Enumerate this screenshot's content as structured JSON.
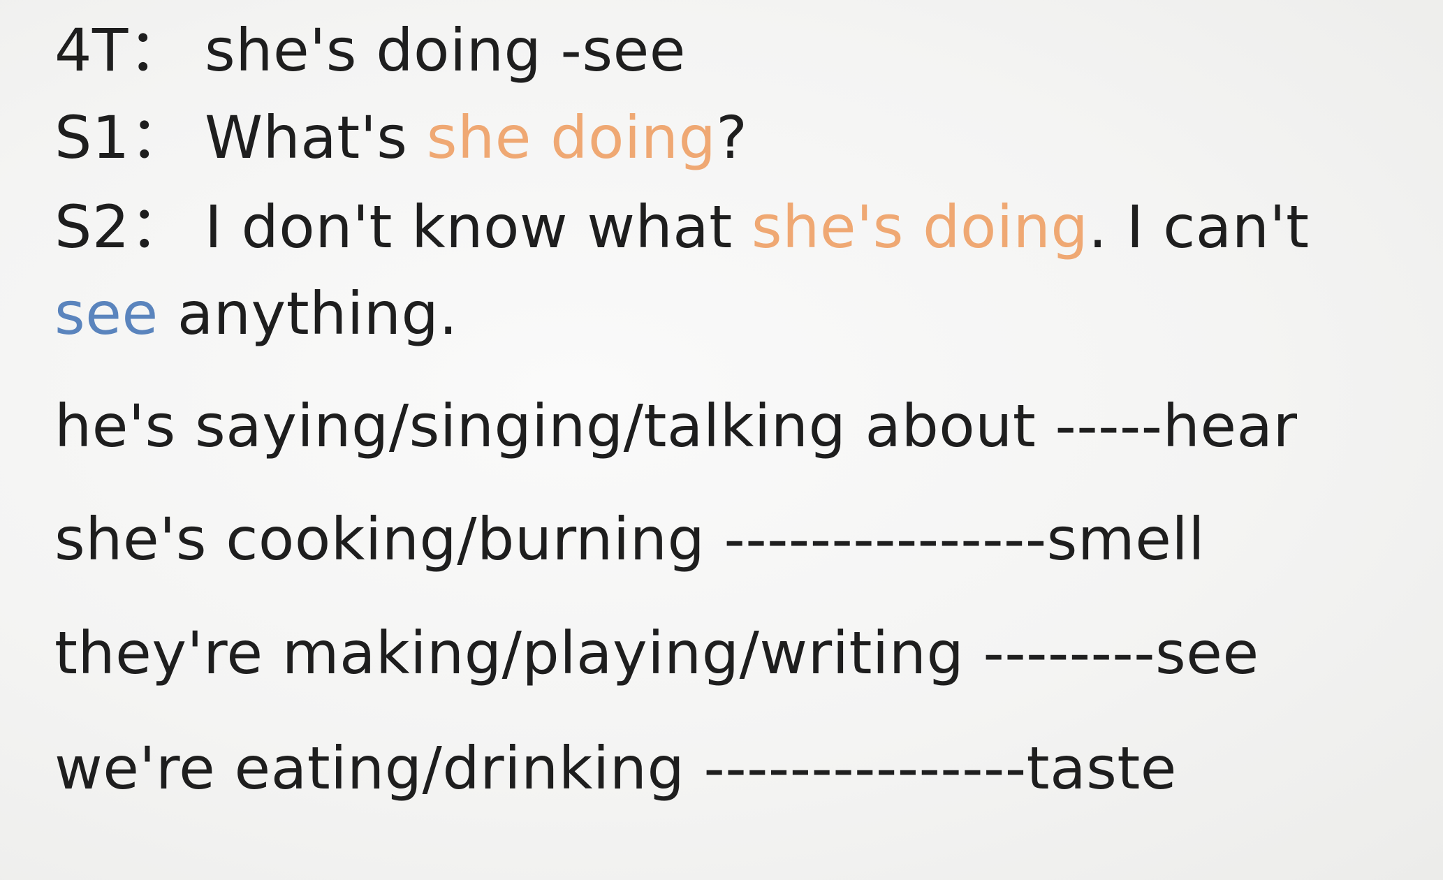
{
  "dialogue": {
    "line1": {
      "speaker": "4T：",
      "text": "she's doing -see"
    },
    "line2": {
      "speaker": "S1：",
      "before": "What's ",
      "highlight": "she doing",
      "after": "?"
    },
    "line3": {
      "speaker": "S2：",
      "before": "I don't know what ",
      "highlight": "she's doing",
      "after": ". I can't"
    },
    "line4": {
      "highlight": "see",
      "after": " anything."
    }
  },
  "verbs": [
    "he's saying/singing/talking about -----hear",
    "she's cooking/burning ---------------smell",
    "they're making/playing/writing --------see",
    "we're eating/drinking ---------------taste"
  ],
  "colors": {
    "orange_highlight": "#efa873",
    "blue_highlight": "#5a84bd",
    "text": "#1e1e1e"
  }
}
